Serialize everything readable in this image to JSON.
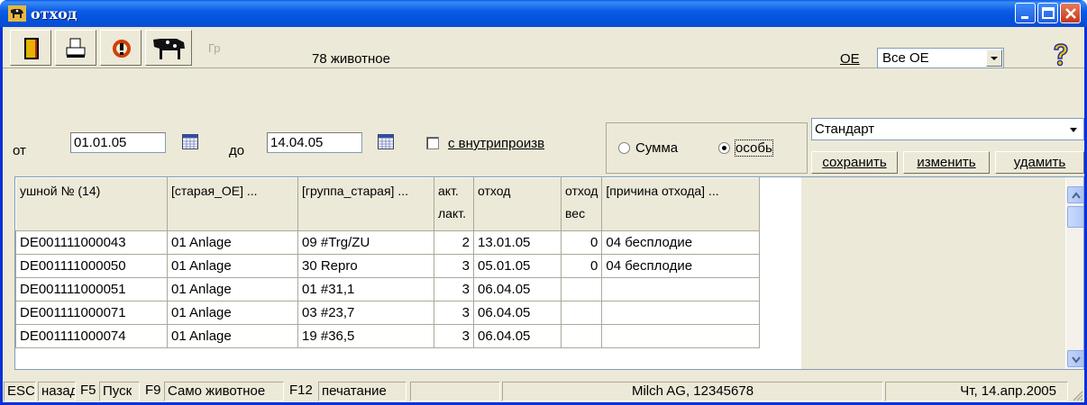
{
  "window": {
    "title": "отход"
  },
  "toolbar": {
    "count_text": "78 животное",
    "disabled_label": "Гр"
  },
  "oe": {
    "label_letters": "ОЕ",
    "selected": "Все ОЕ"
  },
  "filter": {
    "from_label": "от",
    "from_date": "01.01.05",
    "to_label": "до",
    "to_date": "14.04.05",
    "inner_checkbox_label": "с внутрипроизв",
    "sum_label": "Сумма",
    "individual_label": "особь",
    "view_selected": "Стандарт",
    "save_label": "сохранить",
    "edit_label": "изменить",
    "delete_label": "удамить"
  },
  "table": {
    "columns": [
      "ушной № (14)",
      "[старая_ОЕ] ...",
      "[группа_старая] ...",
      "акт. лакт.",
      "отход",
      "отход вес",
      "[причина отхода] ..."
    ],
    "rows": [
      [
        "DE001111000043",
        "01 Anlage",
        "09 #Trg/ZU",
        "2",
        "13.01.05",
        "0",
        "04 бесплодие"
      ],
      [
        "DE001111000050",
        "01 Anlage",
        "30 Repro",
        "3",
        "05.01.05",
        "0",
        "04 бесплодие"
      ],
      [
        "DE001111000051",
        "01 Anlage",
        "01 #31,1",
        "3",
        "06.04.05",
        "",
        ""
      ],
      [
        "DE001111000071",
        "01 Anlage",
        "03 #23,7",
        "3",
        "06.04.05",
        "",
        ""
      ],
      [
        "DE001111000074",
        "01 Anlage",
        "19 #36,5",
        "3",
        "06.04.05",
        "",
        ""
      ]
    ]
  },
  "status": {
    "esc": "ESC",
    "back": "назад",
    "f5": "F5",
    "start": "Пуск",
    "f9": "F9",
    "self_animal": "Само животное",
    "f12": "F12",
    "print": "печатание",
    "company": "Milch AG, 12345678",
    "date": "Чт, 14.апр.2005"
  },
  "colors": {
    "titlebar": "#0a4cd3",
    "window_bg": "#ece9d8",
    "close": "#c3381b"
  }
}
